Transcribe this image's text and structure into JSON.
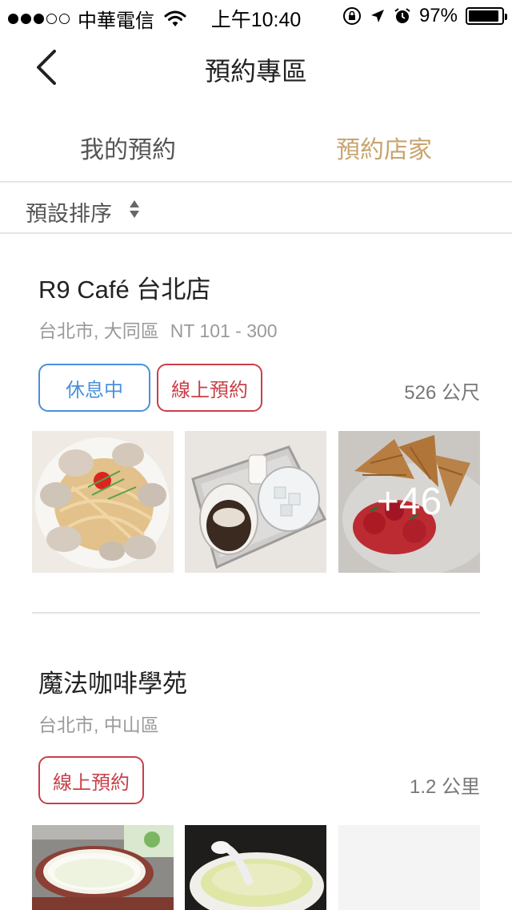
{
  "status_bar": {
    "carrier": "中華電信",
    "time": "上午10:40",
    "battery": "97%",
    "battery_level": 0.97,
    "signal_bars_filled": 3,
    "signal_bars_total": 5
  },
  "nav": {
    "title": "預約專區",
    "back_icon": "chevron-left-icon"
  },
  "tabs": [
    {
      "label": "我的預約",
      "active": false
    },
    {
      "label": "預約店家",
      "active": true
    }
  ],
  "sort": {
    "label": "預設排序",
    "icon": "sort-updown-icon"
  },
  "colors": {
    "accent": "#c8a46e",
    "status_blue": "#4a90d9",
    "reserve_red": "#c9404a",
    "meta_gray": "#9a9a9a"
  },
  "stores": [
    {
      "name": "R9 Café 台北店",
      "location": "台北市, 大同區",
      "price": "NT 101 - 300",
      "status_badge": "休息中",
      "reserve_badge": "線上預約",
      "distance": "526 公尺",
      "photos": [
        "pasta-with-clams",
        "affogato-coffee-tray",
        "waffle-with-strawberries"
      ],
      "more_photos": "+46"
    },
    {
      "name": "魔法咖啡學苑",
      "location": "台北市, 中山區",
      "reserve_badge": "線上預約",
      "distance": "1.2 公里",
      "photos": [
        "matcha-latte-cup",
        "green-tea-cup",
        "placeholder"
      ]
    }
  ]
}
